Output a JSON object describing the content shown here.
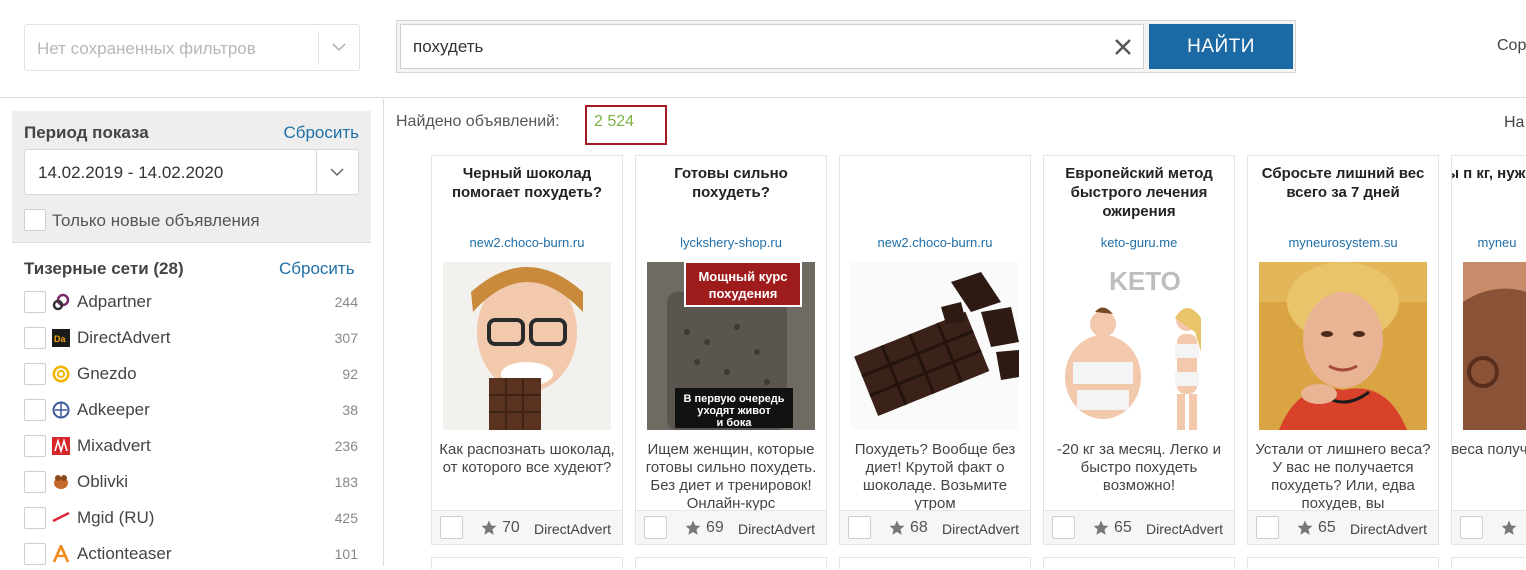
{
  "header": {
    "saved_filters_placeholder": "Нет сохраненных фильтров",
    "search_value": "похудеть",
    "search_button": "НАЙТИ",
    "sort_label": "Сор"
  },
  "sidebar": {
    "period": {
      "title": "Период показа",
      "reset": "Сбросить",
      "date_range": "14.02.2019 - 14.02.2020",
      "new_only_label": "Только новые объявления"
    },
    "networks": {
      "title": "Тизерные сети (28)",
      "reset": "Сбросить",
      "items": [
        {
          "name": "Adpartner",
          "count": "244",
          "icon": "adpartner-logo"
        },
        {
          "name": "DirectAdvert",
          "count": "307",
          "icon": "directadvert-logo"
        },
        {
          "name": "Gnezdo",
          "count": "92",
          "icon": "gnezdo-logo"
        },
        {
          "name": "Adkeeper",
          "count": "38",
          "icon": "adkeeper-logo"
        },
        {
          "name": "Mixadvert",
          "count": "236",
          "icon": "mixadvert-logo"
        },
        {
          "name": "Oblivki",
          "count": "183",
          "icon": "oblivki-logo"
        },
        {
          "name": "Mgid (RU)",
          "count": "425",
          "icon": "mgid-logo"
        },
        {
          "name": "Actionteaser",
          "count": "101",
          "icon": "actionteaser-logo"
        }
      ]
    }
  },
  "results": {
    "found_label": "Найдено объявлений:",
    "found_count": "2 524",
    "nav_label": "На",
    "cards": [
      {
        "title": "Черный шоколад помогает похудеть?",
        "domain": "new2.choco-burn.ru",
        "desc": "Как распознать шоколад, от которого все худеют?",
        "rating": "70",
        "network": "DirectAdvert"
      },
      {
        "title": "Готовы сильно похудеть?",
        "domain": "lyckshery-shop.ru",
        "desc": "Ищем женщин, которые готовы сильно похудеть. Без диет и тренировок! Онлайн-курс",
        "rating": "69",
        "network": "DirectAdvert",
        "img_top_text": "Мощный курс похудения",
        "img_bottom_text": "В первую очередь уходят живот и бока"
      },
      {
        "title": "",
        "domain": "new2.choco-burn.ru",
        "desc": "Похудеть? Вообще без диет! Крутой факт о шоколаде. Возьмите утром",
        "rating": "68",
        "network": "DirectAdvert"
      },
      {
        "title": "Европейский метод быстрого лечения ожирения",
        "domain": "keto-guru.me",
        "desc": "-20 кг за месяц. Легко и быстро похудеть возможно!",
        "rating": "65",
        "network": "DirectAdvert",
        "img_text": "KETO"
      },
      {
        "title": "Сбросьте лишний вес всего за 7 дней",
        "domain": "myneurosystem.su",
        "desc": "Устали от лишнего веса? У вас не получается похудеть? Или, едва похудев, вы",
        "rating": "65",
        "network": "DirectAdvert"
      },
      {
        "title": "Чтобы п кг, нуж делать",
        "domain": "myneu",
        "desc": "Устал веса получ Или, ед",
        "rating": "",
        "network": ""
      }
    ]
  },
  "colors": {
    "accent_blue": "#1b6aa5",
    "link_blue": "#1f6fa8",
    "found_count_green": "#7cb342",
    "highlight_red": "#a11a24"
  }
}
